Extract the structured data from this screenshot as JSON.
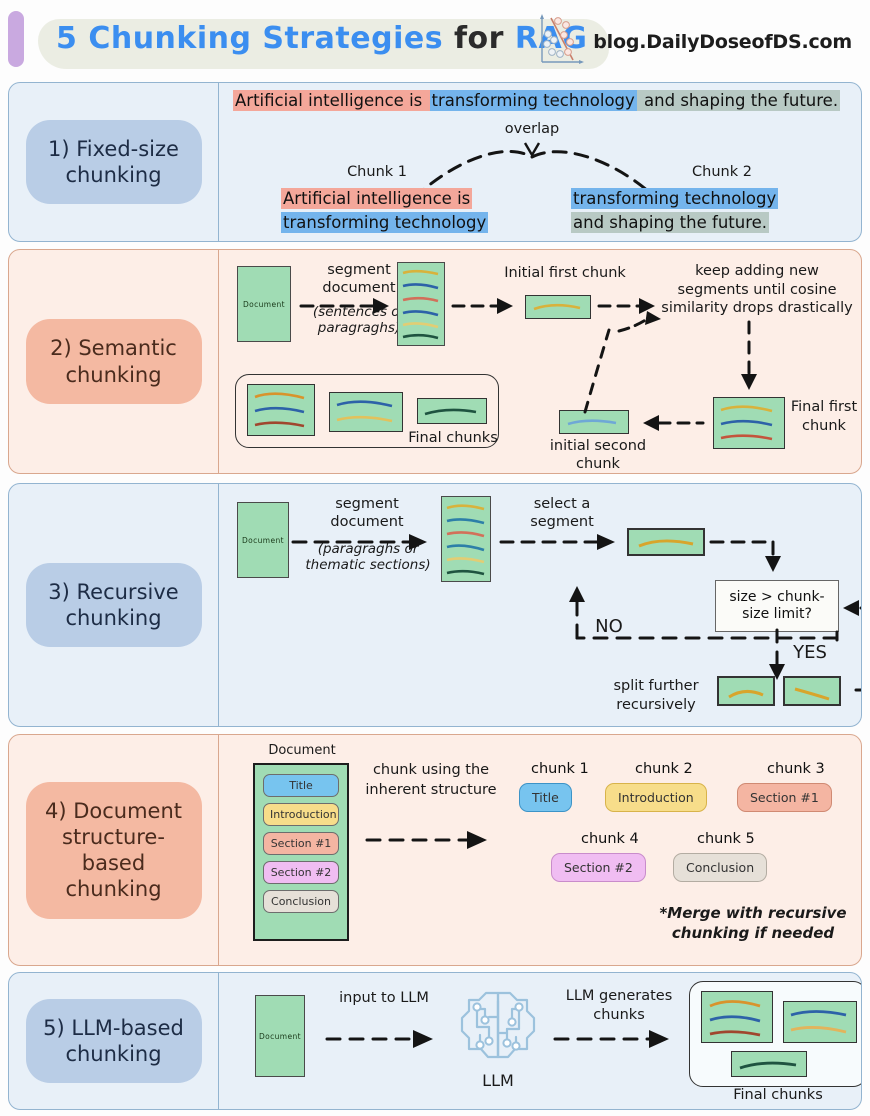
{
  "header": {
    "title_parts": [
      {
        "text": "5 Chunking Strategies",
        "style": "blue"
      },
      {
        "text": " for ",
        "style": "dark"
      },
      {
        "text": "RAG",
        "style": "blue"
      }
    ],
    "title_plain": "5 Chunking Strategies for RAG",
    "brand": "blog.DailyDoseofDS.com",
    "logo_icon": "scatter-plot-classifier-icon",
    "accent_purple": "#c9a9e0",
    "accent_blue": "#3b8ef0"
  },
  "sections": [
    {
      "id": "fixed-size",
      "label": "1) Fixed-size chunking",
      "theme": "blue",
      "sentence": [
        {
          "text": "Artificial intelligence is ",
          "hl": "red"
        },
        {
          "text": "transforming technology",
          "hl": "blue"
        },
        {
          "text": " and shaping the future.",
          "hl": "gray"
        }
      ],
      "overlap_label": "overlap",
      "chunk1_label": "Chunk 1",
      "chunk2_label": "Chunk 2",
      "chunk1_lines": [
        {
          "text": "Artificial intelligence is",
          "hl": "red"
        },
        {
          "text": "transforming technology",
          "hl": "blue"
        }
      ],
      "chunk2_lines": [
        {
          "text": "transforming technology",
          "hl": "blue"
        },
        {
          "text": "and shaping the future.",
          "hl": "gray"
        }
      ]
    },
    {
      "id": "semantic",
      "label": "2) Semantic chunking",
      "theme": "peach",
      "document_label": "Document",
      "segment_caption_line1": "segment",
      "segment_caption_line2": "document",
      "segment_caption_note": "(sentences or paragraghs)",
      "initial_first_chunk": "Initial first chunk",
      "keep_adding_note": "keep adding new segments until cosine similarity drops drastically",
      "final_first_chunk": "Final first chunk",
      "initial_second_chunk": "initial second chunk",
      "final_chunks": "Final chunks"
    },
    {
      "id": "recursive",
      "label": "3) Recursive chunking",
      "theme": "blue",
      "document_label": "Document",
      "segment_caption_line1": "segment",
      "segment_caption_line2": "document",
      "segment_caption_note": "(paragraghs or thematic sections)",
      "select_segment": "select a segment",
      "decision": "size > chunk-size limit?",
      "no_label": "NO",
      "yes_label": "YES",
      "split_further": "split further recursively"
    },
    {
      "id": "document-structure",
      "label": "4) Document structure-based chunking",
      "theme": "peach",
      "document_label": "Document",
      "doc_pills": [
        {
          "text": "Title",
          "color": "#77c4ef"
        },
        {
          "text": "Introduction",
          "color": "#f7dd8a"
        },
        {
          "text": "Section #1",
          "color": "#f4b5a2"
        },
        {
          "text": "Section #2",
          "color": "#f0bdf2"
        },
        {
          "text": "Conclusion",
          "color": "#e6e0d8"
        }
      ],
      "arrow_caption": "chunk using the inherent structure",
      "chunks": [
        {
          "label": "chunk 1",
          "text": "Title",
          "color": "#77c4ef"
        },
        {
          "label": "chunk 2",
          "text": "Introduction",
          "color": "#f7dd8a"
        },
        {
          "label": "chunk 3",
          "text": "Section #1",
          "color": "#f4b5a2"
        },
        {
          "label": "chunk 4",
          "text": "Section #2",
          "color": "#f0bdf2"
        },
        {
          "label": "chunk 5",
          "text": "Conclusion",
          "color": "#e6e0d8"
        }
      ],
      "footnote": "*Merge with recursive chunking if needed"
    },
    {
      "id": "llm-based",
      "label": "5) LLM-based chunking",
      "theme": "blue",
      "document_label": "Document",
      "input_caption": "input to LLM",
      "llm_icon": "circuit-brain-icon",
      "llm_label": "LLM",
      "generate_caption": "LLM generates chunks",
      "final_chunks": "Final chunks"
    }
  ],
  "palette": {
    "highlight_red": "#f4a79a",
    "highlight_blue": "#74b4ec",
    "highlight_gray": "#b8c9c4",
    "doc_green": "#a0dcb4",
    "blue_section_bg": "#e8f0f8",
    "peach_section_bg": "#fdeee7",
    "blue_chip": "#b9cde6",
    "peach_chip": "#f4b9a2"
  }
}
